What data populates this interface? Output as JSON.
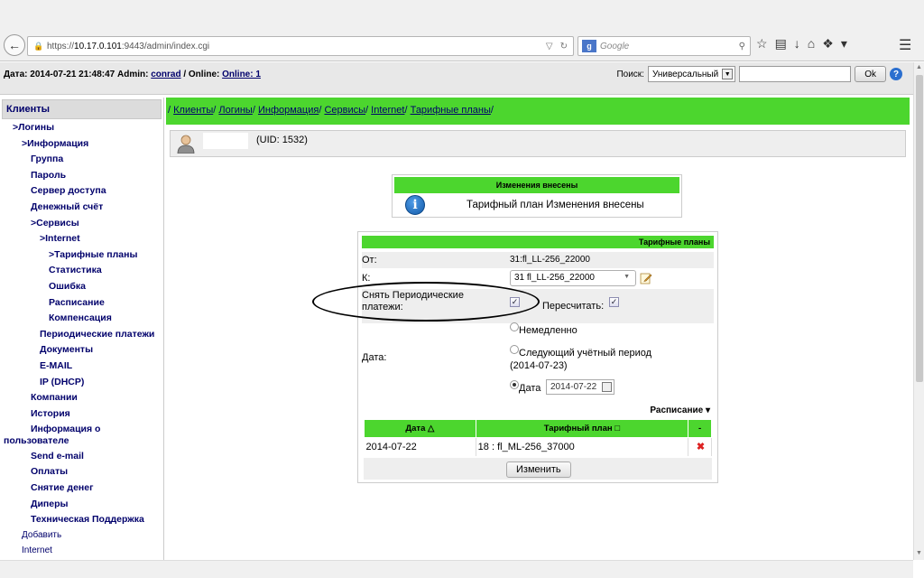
{
  "browser": {
    "url_prefix": "https://",
    "url_host": "10.17.0.101",
    "url_rest": ":9443/admin/index.cgi",
    "search_engine": "g",
    "search_placeholder": "Google"
  },
  "header": {
    "date_label": "Дата: 2014-07-21 21:48:47 Admin:",
    "admin": "conrad",
    "online_label": "/ Online:",
    "online_link": "Online: 1",
    "search_label": "Поиск:",
    "search_type": "Универсальный",
    "ok_button": "Ok",
    "help": "?"
  },
  "sidebar": {
    "title": "Клиенты",
    "items": [
      {
        "label": ">Логины"
      },
      {
        "label": ">Информация"
      },
      {
        "label": "Группа"
      },
      {
        "label": "Пароль"
      },
      {
        "label": "Сервер доступа"
      },
      {
        "label": "Денежный счёт"
      },
      {
        "label": ">Сервисы"
      },
      {
        "label": ">Internet"
      },
      {
        "label": ">Тарифные планы"
      },
      {
        "label": "Статистика"
      },
      {
        "label": "Ошибка"
      },
      {
        "label": "Расписание"
      },
      {
        "label": "Компенсация"
      },
      {
        "label": "Периодические платежи"
      },
      {
        "label": "Документы"
      },
      {
        "label": "E-MAIL"
      },
      {
        "label": "IP (DHCP)"
      },
      {
        "label": "Компании"
      },
      {
        "label": "История"
      },
      {
        "label": "Информация о"
      },
      {
        "label": "пользователе"
      },
      {
        "label": "Send e-mail"
      },
      {
        "label": "Оплаты"
      },
      {
        "label": "Снятие денег"
      },
      {
        "label": "Диперы"
      },
      {
        "label": "Техническая Поддержка"
      },
      {
        "label": "Добавить"
      },
      {
        "label": "Internet"
      }
    ]
  },
  "breadcrumb": {
    "sep": "/ ",
    "items": [
      "Клиенты",
      "Логины",
      "Информация",
      "Сервисы",
      "Internet",
      "Тарифные планы"
    ]
  },
  "user": {
    "uid": "(UID: 1532)"
  },
  "message": {
    "title": "Изменения внесены",
    "text": "Тарифный план Изменения внесены"
  },
  "tariff_form": {
    "title": "Тарифные планы",
    "from_label": "От:",
    "from_value": "31:fl_LL-256_22000",
    "to_label": "К:",
    "to_value": "31 fl_LL-256_22000",
    "remove_periodic_label_1": "Снять Периодические",
    "remove_periodic_label_2": "платежи:",
    "remove_periodic_checked": true,
    "recalc_label": "Пересчитать:",
    "recalc_checked": true,
    "date_label": "Дата:",
    "opt_now": "Немедленно",
    "opt_next_1": "Следующий учётный период",
    "opt_next_2": "(2014-07-23)",
    "opt_date": "Дата",
    "date_value": "2014-07-22",
    "selected_option": "date"
  },
  "schedule": {
    "label": "Расписание",
    "columns": [
      "Дата",
      "Тарифный план",
      "-"
    ],
    "rows": [
      {
        "date": "2014-07-22",
        "plan": "18 : fl_ML-256_37000"
      }
    ],
    "change_button": "Изменить"
  }
}
